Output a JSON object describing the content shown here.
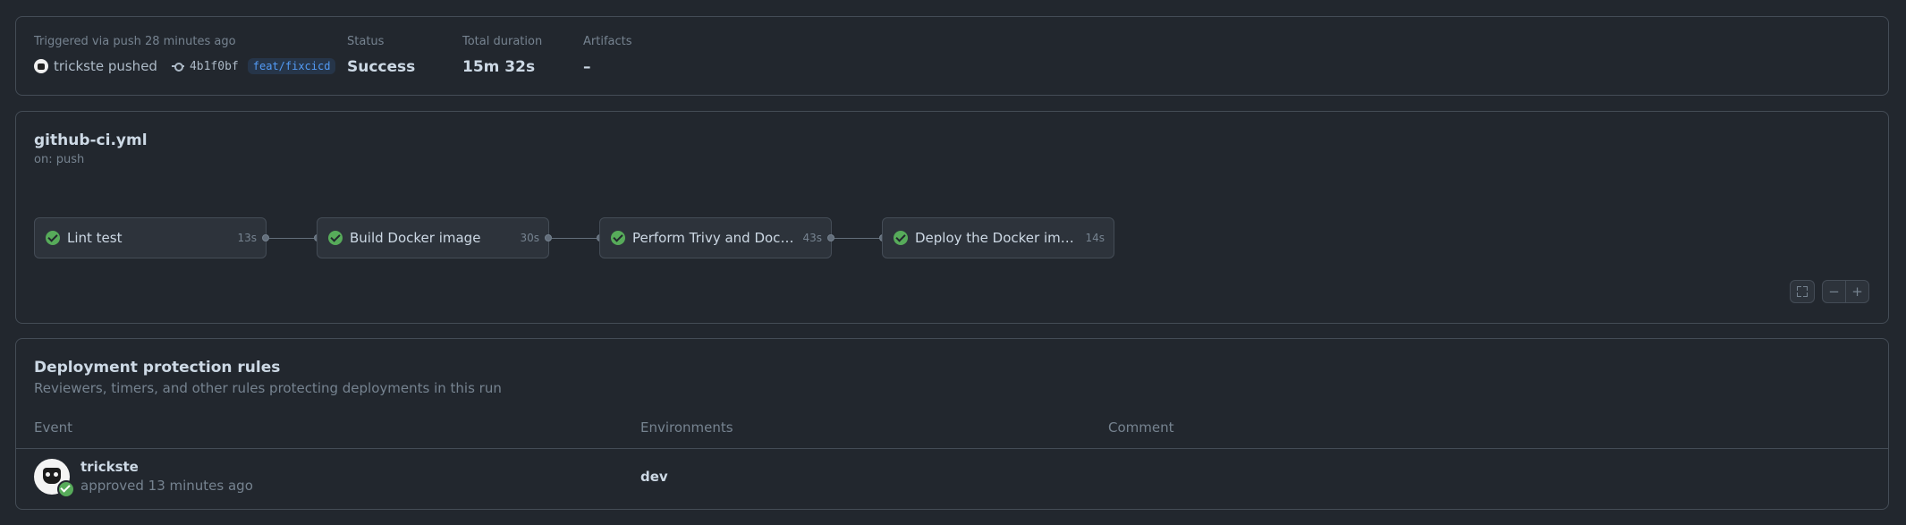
{
  "summary": {
    "trigger_text": "Triggered via push 28 minutes ago",
    "actor": "trickste pushed",
    "commit_sha": "4b1f0bf",
    "branch": "feat/fixcicd",
    "status_label": "Status",
    "status_value": "Success",
    "duration_label": "Total duration",
    "duration_value": "15m 32s",
    "artifacts_label": "Artifacts",
    "artifacts_value": "–"
  },
  "workflow": {
    "file": "github-ci.yml",
    "trigger": "on: push",
    "jobs": [
      {
        "name": "Lint test",
        "duration": "13s",
        "status": "success"
      },
      {
        "name": "Build Docker image",
        "duration": "30s",
        "status": "success"
      },
      {
        "name": "Perform Trivy and Dockle t...",
        "duration": "43s",
        "status": "success"
      },
      {
        "name": "Deploy the Docker image",
        "duration": "14s",
        "status": "success"
      }
    ],
    "controls": {
      "zoom_out": "−",
      "zoom_in": "+"
    }
  },
  "deployment": {
    "title": "Deployment protection rules",
    "subtitle": "Reviewers, timers, and other rules protecting deployments in this run",
    "columns": [
      "Event",
      "Environments",
      "Comment"
    ],
    "rows": [
      {
        "user": "trickste",
        "event": "approved 13 minutes ago",
        "environment": "dev",
        "comment": ""
      }
    ]
  },
  "colors": {
    "background": "#22272e",
    "border": "#444c56",
    "success": "#57ab5a",
    "branch_text": "#539bf5"
  },
  "icons": [
    "check-circle-icon",
    "commit-icon",
    "fullscreen-icon",
    "zoom-out-icon",
    "zoom-in-icon",
    "avatar"
  ]
}
